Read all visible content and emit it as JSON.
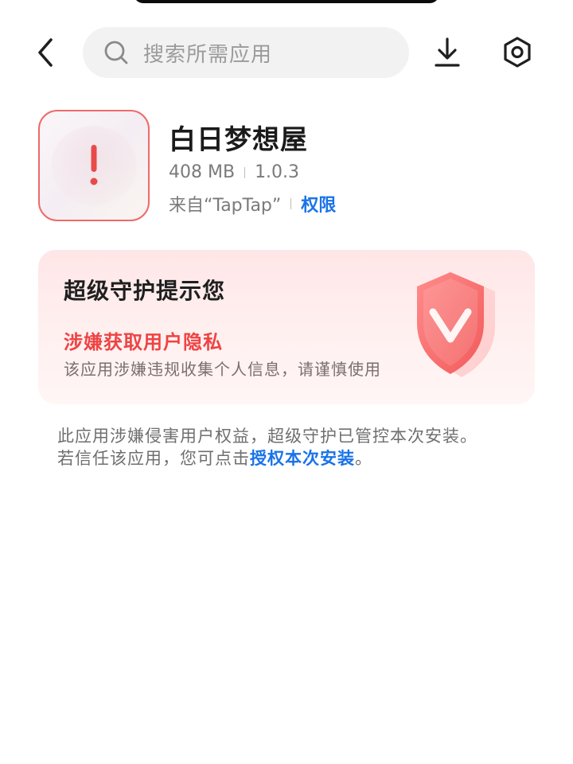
{
  "search": {
    "placeholder": "搜索所需应用"
  },
  "app": {
    "name": "白日梦想屋",
    "size": "408 MB",
    "version": "1.0.3",
    "source": "来自“TapTap”",
    "permission_link": "权限"
  },
  "guard_card": {
    "title": "超级守护提示您",
    "risk": "涉嫌获取用户隐私",
    "description": "该应用涉嫌违规收集个人信息，请谨慎使用"
  },
  "notice": {
    "line1": "此应用涉嫌侵害用户权益，超级守护已管控本次安装。",
    "line2_prefix": "若信任该应用，您可点击",
    "line2_link": "授权本次安装",
    "line2_suffix": "。"
  },
  "icons": {
    "back": "back-arrow-icon",
    "search": "search-icon",
    "download": "download-icon",
    "settings": "settings-icon",
    "warning": "exclamation-icon",
    "shield": "shield-check-icon"
  },
  "colors": {
    "accent_blue": "#1a73e8",
    "warning_red": "#ee4444",
    "card_pink": "#ffe6e7"
  }
}
